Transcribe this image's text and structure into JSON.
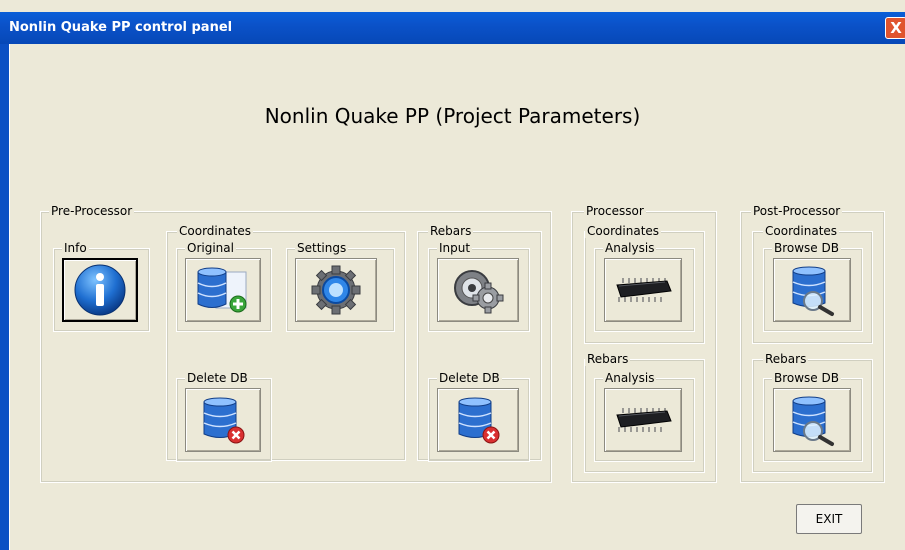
{
  "window": {
    "title": "Nonlin Quake PP control panel",
    "close_label": "X"
  },
  "main_title": "Nonlin Quake PP (Project Parameters)",
  "pre": {
    "label": "Pre-Processor",
    "info_label": "Info",
    "coordinates": {
      "label": "Coordinates",
      "original_label": "Original",
      "settings_label": "Settings",
      "delete_label": "Delete DB"
    },
    "rebars": {
      "label": "Rebars",
      "input_label": "Input",
      "delete_label": "Delete DB"
    }
  },
  "processor": {
    "label": "Processor",
    "coordinates": {
      "label": "Coordinates",
      "analysis_label": "Analysis"
    },
    "rebars": {
      "label": "Rebars",
      "analysis_label": "Analysis"
    }
  },
  "post": {
    "label": "Post-Processor",
    "coordinates": {
      "label": "Coordinates",
      "browse_label": "Browse DB"
    },
    "rebars": {
      "label": "Rebars",
      "browse_label": "Browse DB"
    }
  },
  "exit_label": "EXIT",
  "icons": [
    "info-icon",
    "database-add-icon",
    "gear-icon",
    "database-delete-icon",
    "rebar-settings-icon",
    "chip-icon",
    "database-search-icon"
  ]
}
